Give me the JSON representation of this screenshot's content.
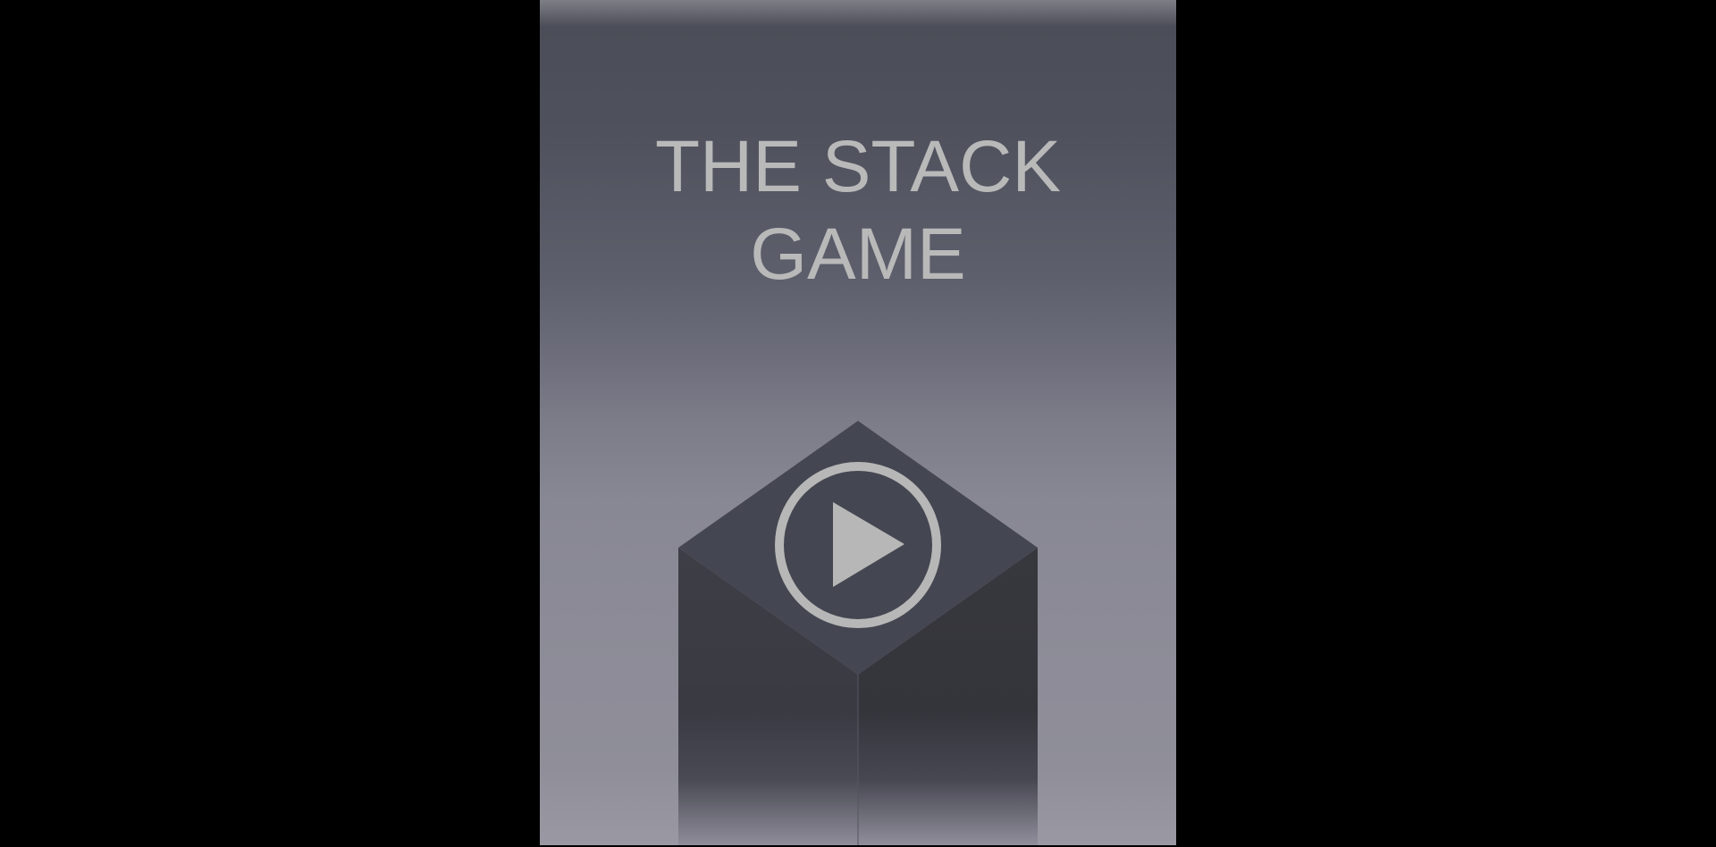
{
  "game": {
    "title_line_1": "THE STACK",
    "title_line_2": "GAME"
  },
  "icons": {
    "play": "play-icon"
  },
  "colors": {
    "page_background": "#000000",
    "title_text": "#b9b9b9",
    "block_top": "#444651",
    "block_left": "#3b3c44",
    "block_right": "#35363c",
    "play_icon": "#b7b7b7"
  }
}
